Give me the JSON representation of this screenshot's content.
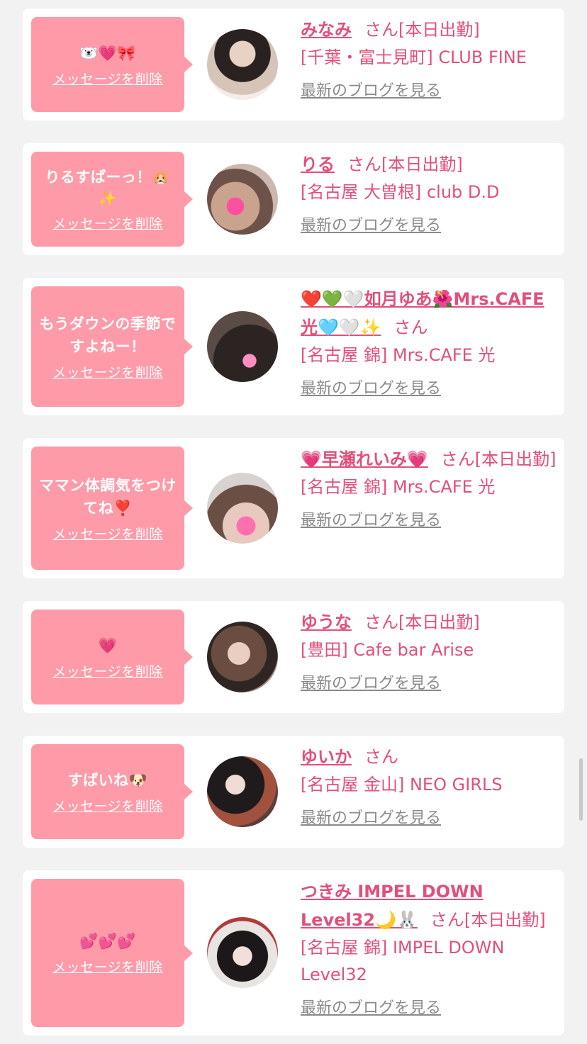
{
  "delete_label": "メッセージを削除",
  "blog_label": "最新のブログを見る",
  "san_label": "さん",
  "cards": [
    {
      "message": "🐻‍❄️💗🎀",
      "name": "みなみ",
      "status": "[本日出勤]",
      "shop": "[千葉・富士見町] CLUB FINE"
    },
    {
      "message": "りるすぱーっ！🐹✨",
      "name": "りる",
      "status": "[本日出勤]",
      "shop": "[名古屋 大曽根] club D.D"
    },
    {
      "message": "もうダウンの季節ですよねー！",
      "name": "❤️💚🤍如月ゆあ🌺Mrs.CAFE光🩵🤍✨",
      "status": "",
      "shop": "[名古屋 錦] Mrs.CAFE 光"
    },
    {
      "message": "ママン体調気をつけてね❣️",
      "name": "💗早瀬れいみ💗",
      "status": "[本日出勤]",
      "shop": "[名古屋 錦] Mrs.CAFE 光"
    },
    {
      "message": "💗",
      "name": "ゆうな",
      "status": "[本日出勤]",
      "shop": "[豊田] Cafe bar Arise"
    },
    {
      "message": "すぱいね🐶",
      "name": "ゆいか",
      "status": "",
      "shop": "[名古屋 金山] NEO GIRLS"
    },
    {
      "message": "💕💕💕",
      "name": "つきみ IMPEL DOWN Level32🌙🐰",
      "status": "[本日出勤]",
      "shop": "[名古屋 錦] IMPEL DOWN Level32"
    }
  ],
  "colors": {
    "background": "#f2f2f2",
    "bubble": "#ff9aa8",
    "accent": "#e24f7a",
    "link_gray": "#8a8a8a"
  }
}
